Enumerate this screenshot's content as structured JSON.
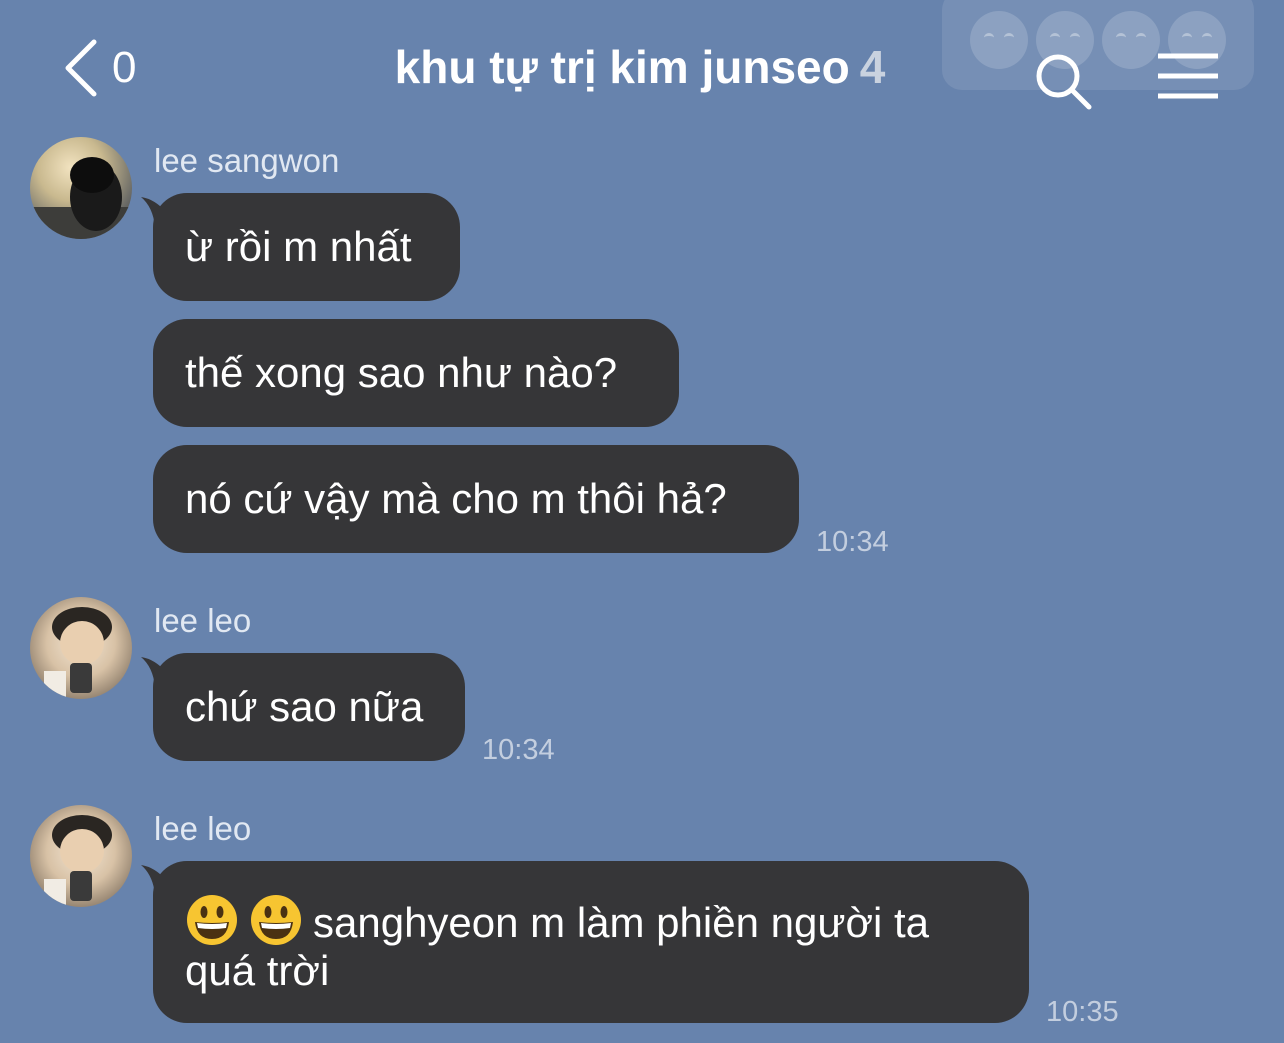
{
  "header": {
    "back_count": "0",
    "title": "khu tự trị kim junseo",
    "member_count": "4"
  },
  "icons": {
    "back": "chevron-left-icon",
    "search": "search-icon",
    "menu": "hamburger-menu-icon",
    "reactions": "crying-emoji-icon"
  },
  "colors": {
    "background": "#6783ad",
    "bubble": "#363638",
    "text": "#ffffff",
    "timestamp": "#c3cedf"
  },
  "messages": [
    {
      "sender": "lee sangwon",
      "bubbles": [
        "ừ rồi m nhất",
        "thế xong sao như nào?",
        "nó cứ vậy mà cho m thôi hả?"
      ],
      "time": "10:34"
    },
    {
      "sender": "lee leo",
      "bubbles": [
        "chứ sao nữa"
      ],
      "time": "10:34"
    },
    {
      "sender": "lee leo",
      "emoji": "grinning-face-icon",
      "bubbles": [
        "sanghyeon m làm phiền người ta quá trời"
      ],
      "time": "10:35"
    }
  ]
}
